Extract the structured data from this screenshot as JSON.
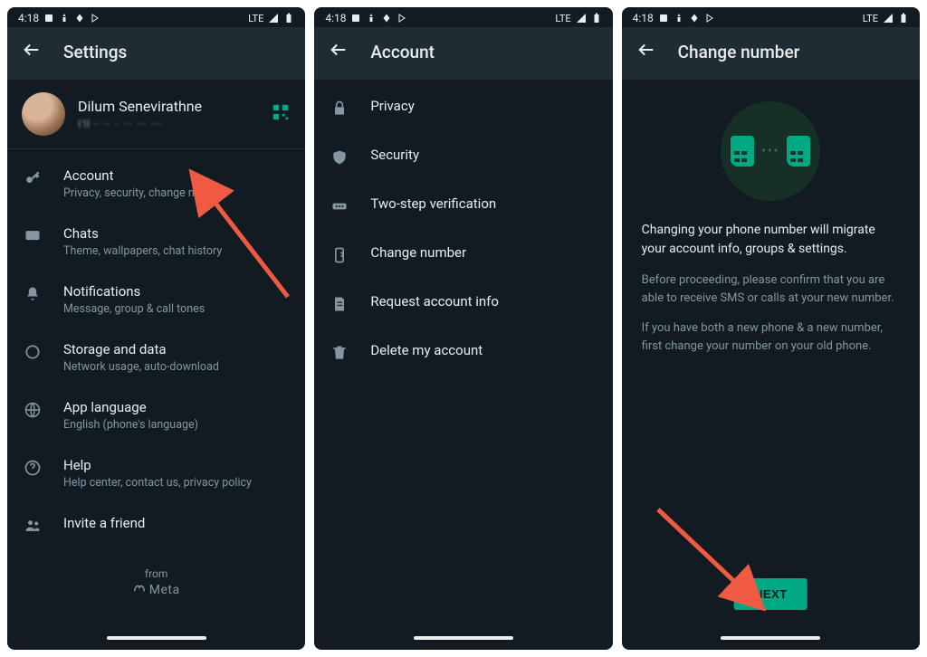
{
  "statusbar": {
    "time": "4:18",
    "network_label": "LTE"
  },
  "screens": {
    "settings": {
      "title": "Settings",
      "profile": {
        "name": "Dilum Senevirathne",
        "status_obscured": "I'll ·· ·· ··  ··· ··· ····"
      },
      "items": [
        {
          "title": "Account",
          "subtitle": "Privacy, security, change number"
        },
        {
          "title": "Chats",
          "subtitle": "Theme, wallpapers, chat history"
        },
        {
          "title": "Notifications",
          "subtitle": "Message, group & call tones"
        },
        {
          "title": "Storage and data",
          "subtitle": "Network usage, auto-download"
        },
        {
          "title": "App language",
          "subtitle": "English (phone's language)"
        },
        {
          "title": "Help",
          "subtitle": "Help center, contact us, privacy policy"
        },
        {
          "title": "Invite a friend",
          "subtitle": ""
        }
      ],
      "footer": {
        "from": "from",
        "brand": "Meta"
      }
    },
    "account": {
      "title": "Account",
      "items": [
        {
          "title": "Privacy"
        },
        {
          "title": "Security"
        },
        {
          "title": "Two-step verification"
        },
        {
          "title": "Change number"
        },
        {
          "title": "Request account info"
        },
        {
          "title": "Delete my account"
        }
      ]
    },
    "change_number": {
      "title": "Change number",
      "paragraphs": [
        "Changing your phone number will migrate your account info, groups & settings.",
        "Before proceeding, please confirm that you are able to receive SMS or calls at your new number.",
        "If you have both a new phone & a new number, first change your number on your old phone."
      ],
      "next_label": "NEXT"
    }
  }
}
